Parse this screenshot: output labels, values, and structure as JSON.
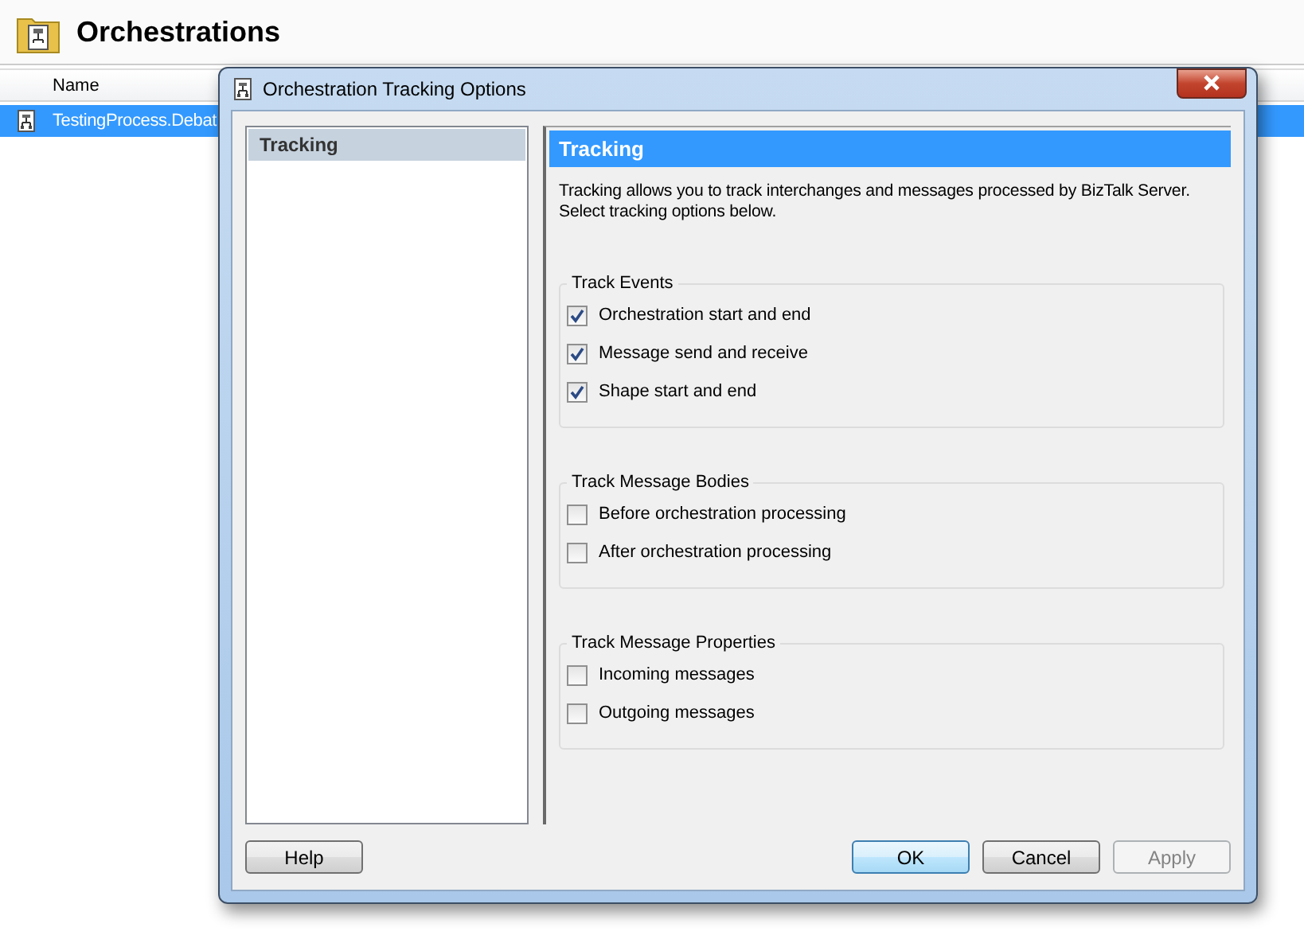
{
  "background": {
    "title": "Orchestrations",
    "columns": [
      {
        "label": "Name"
      }
    ],
    "rows": [
      {
        "name": "TestingProcess.Debat",
        "selected": true
      }
    ]
  },
  "dialog": {
    "title": "Orchestration Tracking Options",
    "nav": [
      {
        "label": "Tracking",
        "selected": true
      }
    ],
    "pane": {
      "heading": "Tracking",
      "description": "Tracking allows you to track interchanges and messages processed by BizTalk Server. Select tracking options below.",
      "groups": [
        {
          "title": "Track Events",
          "options": [
            {
              "label": "Orchestration start and end",
              "checked": true
            },
            {
              "label": "Message send and receive",
              "checked": true
            },
            {
              "label": "Shape start and end",
              "checked": true
            }
          ]
        },
        {
          "title": "Track Message Bodies",
          "options": [
            {
              "label": "Before orchestration processing",
              "checked": false
            },
            {
              "label": "After orchestration processing",
              "checked": false
            }
          ]
        },
        {
          "title": "Track Message Properties",
          "options": [
            {
              "label": "Incoming messages",
              "checked": false
            },
            {
              "label": "Outgoing messages",
              "checked": false
            }
          ]
        }
      ]
    },
    "left_buttons": [
      {
        "label": "Help",
        "default": false,
        "disabled": false
      }
    ],
    "right_buttons": [
      {
        "label": "OK",
        "default": true,
        "disabled": false
      },
      {
        "label": "Cancel",
        "default": false,
        "disabled": false
      },
      {
        "label": "Apply",
        "default": false,
        "disabled": true
      }
    ]
  }
}
